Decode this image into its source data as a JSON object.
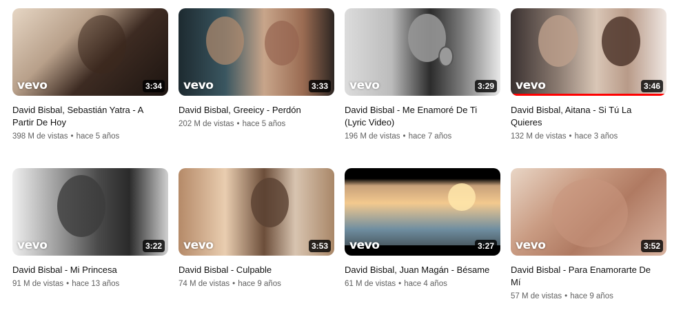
{
  "videos": [
    {
      "title_line1": "David Bisbal, Sebastián Yatra - A",
      "title_line2": "Partir De Hoy",
      "views": "398 M de vistas",
      "age": "hace 5 años",
      "duration": "3:34",
      "brand": "vevo",
      "watched_fraction": 0
    },
    {
      "title_line1": "David Bisbal, Greeicy - Perdón",
      "title_line2": "",
      "views": "202 M de vistas",
      "age": "hace 5 años",
      "duration": "3:33",
      "brand": "vevo",
      "watched_fraction": 0
    },
    {
      "title_line1": "David Bisbal - Me Enamoré De Ti",
      "title_line2": "(Lyric Video)",
      "views": "196 M de vistas",
      "age": "hace 7 años",
      "duration": "3:29",
      "brand": "vevo",
      "watched_fraction": 0
    },
    {
      "title_line1": "David Bisbal, Aitana - Si Tú La",
      "title_line2": "Quieres",
      "views": "132 M de vistas",
      "age": "hace 3 años",
      "duration": "3:46",
      "brand": "vevo",
      "watched_fraction": 1
    },
    {
      "title_line1": "David Bisbal - Mi Princesa",
      "title_line2": "",
      "views": "91 M de vistas",
      "age": "hace 13 años",
      "duration": "3:22",
      "brand": "vevo",
      "watched_fraction": 0
    },
    {
      "title_line1": "David Bisbal - Culpable",
      "title_line2": "",
      "views": "74 M de vistas",
      "age": "hace 9 años",
      "duration": "3:53",
      "brand": "vevo",
      "watched_fraction": 0
    },
    {
      "title_line1": "David Bisbal, Juan Magán - Bésame",
      "title_line2": "",
      "views": "61 M de vistas",
      "age": "hace 4 años",
      "duration": "3:27",
      "brand": "vevo",
      "watched_fraction": 0
    },
    {
      "title_line1": "David Bisbal - Para Enamorarte De",
      "title_line2": "Mí",
      "views": "57 M de vistas",
      "age": "hace 9 años",
      "duration": "3:52",
      "brand": "vevo",
      "watched_fraction": 0
    }
  ],
  "separator": "•",
  "colors": {
    "progress": "#ff0000",
    "title": "#0f0f0f",
    "meta": "#606060"
  }
}
